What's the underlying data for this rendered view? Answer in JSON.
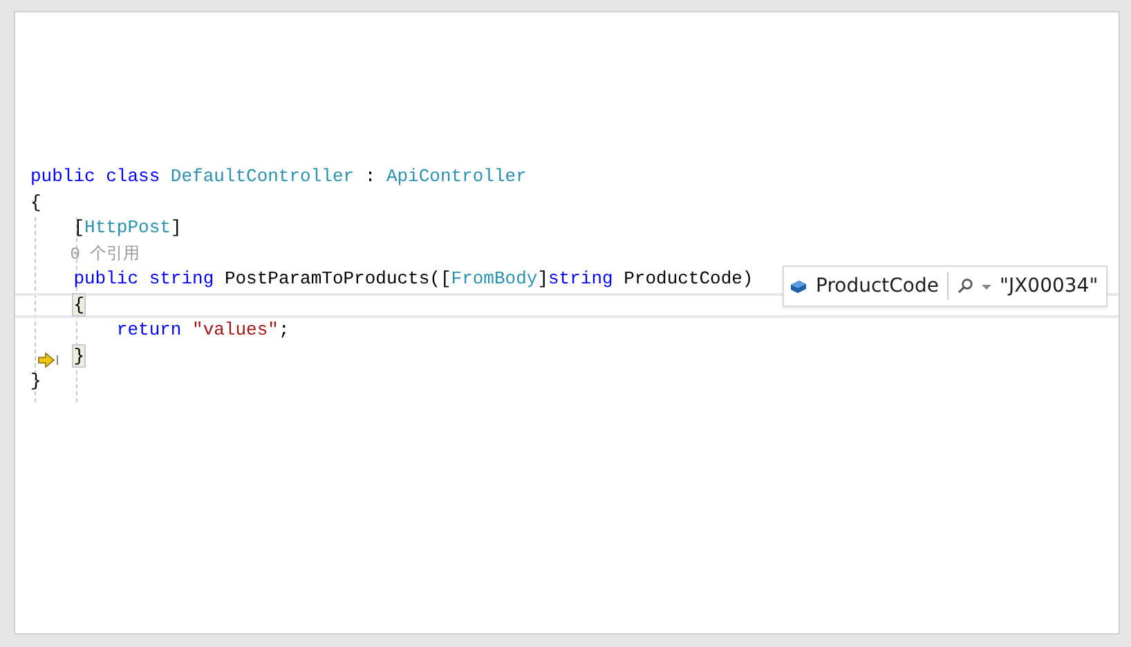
{
  "editor": {
    "lines": [
      {
        "current": false,
        "arrow": false,
        "tokens": [
          {
            "kind": "keyword",
            "text": "public class "
          },
          {
            "kind": "type",
            "text": "DefaultController"
          },
          {
            "kind": "plain",
            "text": " : "
          },
          {
            "kind": "type",
            "text": "ApiController"
          }
        ]
      },
      {
        "current": false,
        "arrow": false,
        "tokens": [
          {
            "kind": "plain",
            "text": "{"
          }
        ]
      },
      {
        "current": false,
        "arrow": false,
        "tokens": [
          {
            "kind": "plain",
            "text": "    ["
          },
          {
            "kind": "type",
            "text": "HttpPost"
          },
          {
            "kind": "plain",
            "text": "]"
          }
        ]
      },
      {
        "current": false,
        "arrow": false,
        "tokens": [
          {
            "kind": "lens",
            "text": "    0 个引用"
          }
        ]
      },
      {
        "current": false,
        "arrow": false,
        "tokens": [
          {
            "kind": "keyword",
            "text": "    public string "
          },
          {
            "kind": "plain",
            "text": "PostParamToProducts(["
          },
          {
            "kind": "type",
            "text": "FromBody"
          },
          {
            "kind": "plain",
            "text": "]"
          },
          {
            "kind": "keyword",
            "text": "string "
          },
          {
            "kind": "plain",
            "text": "ProductCode)"
          }
        ]
      },
      {
        "current": true,
        "arrow": false,
        "tokens": [
          {
            "kind": "brace",
            "text": "    {"
          }
        ]
      },
      {
        "current": false,
        "arrow": false,
        "tokens": [
          {
            "kind": "keyword",
            "text": "        return "
          },
          {
            "kind": "string",
            "text": "\"values\""
          },
          {
            "kind": "plain",
            "text": ";"
          }
        ]
      },
      {
        "current": false,
        "arrow": true,
        "tokens": [
          {
            "kind": "brace",
            "text": "    }"
          }
        ]
      },
      {
        "current": false,
        "arrow": false,
        "tokens": [
          {
            "kind": "plain",
            "text": "}"
          }
        ]
      }
    ]
  },
  "datatip": {
    "name": "ProductCode",
    "value": "\"JX00034\""
  }
}
